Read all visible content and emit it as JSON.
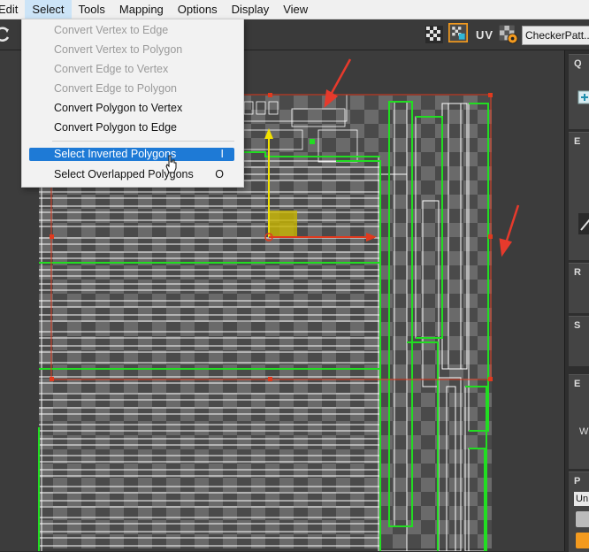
{
  "menubar": {
    "items": [
      "Edit",
      "Select",
      "Tools",
      "Mapping",
      "Options",
      "Display",
      "View"
    ]
  },
  "toolbar": {
    "uv_label": "UV",
    "texture_select": "CheckerPatt...(",
    "icons": [
      "refresh-icon",
      "checker-display-icon",
      "uv-map-icon",
      "checker-texture-icon"
    ]
  },
  "select_menu": {
    "items": [
      {
        "label": "Convert Vertex to Edge",
        "disabled": true,
        "shortcut": ""
      },
      {
        "label": "Convert Vertex to Polygon",
        "disabled": true,
        "shortcut": ""
      },
      {
        "label": "Convert Edge to Vertex",
        "disabled": true,
        "shortcut": ""
      },
      {
        "label": "Convert Edge to Polygon",
        "disabled": true,
        "shortcut": ""
      },
      {
        "label": "Convert Polygon to Vertex",
        "disabled": false,
        "shortcut": ""
      },
      {
        "label": "Convert Polygon to Edge",
        "disabled": false,
        "shortcut": ""
      },
      {
        "label": "Select Inverted Polygons",
        "disabled": false,
        "shortcut": "I",
        "highlighted": true
      },
      {
        "label": "Select Overlapped Polygons",
        "disabled": false,
        "shortcut": "O"
      }
    ]
  },
  "right_panel": {
    "sections": [
      "Q",
      "E",
      "R",
      "S",
      "E",
      "P"
    ],
    "partial_labels": [
      "W",
      "Un"
    ]
  },
  "colors": {
    "highlight": "#1e7ad6",
    "uv_wire": "#ffffff",
    "uv_border_green": "#22dd22",
    "selection_gizmo": "#e03a1e",
    "gizmo_y_axis": "#f2e100",
    "annotation_arrow": "#e63a2c",
    "accent_orange": "#f39a1e"
  }
}
